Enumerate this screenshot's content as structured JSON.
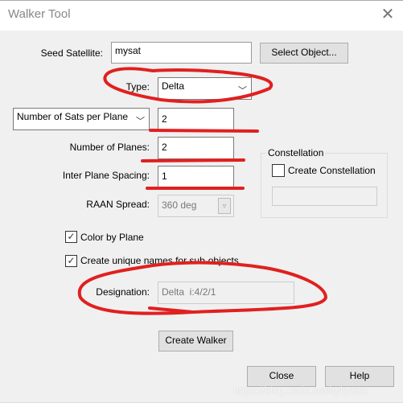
{
  "window": {
    "title": "Walker Tool",
    "close_icon": "close-icon"
  },
  "form": {
    "seed_label": "Seed Satellite:",
    "seed_value": "mysat",
    "select_object": "Select Object...",
    "type_label": "Type:",
    "type_value": "Delta",
    "sats_mode": "Number of Sats per Plane",
    "sats_value": "2",
    "planes_label": "Number of Planes:",
    "planes_value": "2",
    "spacing_label": "Inter Plane Spacing:",
    "spacing_value": "1",
    "raan_label": "RAAN Spread:",
    "raan_value": "360 deg",
    "color_by_plane": "Color by Plane",
    "color_by_plane_checked": true,
    "unique_names": "Create unique names for sub-objects",
    "unique_names_checked": true,
    "designation_label": "Designation:",
    "designation_value": "Delta  i:4/2/1",
    "create_walker": "Create Walker"
  },
  "constellation": {
    "legend": "Constellation",
    "create_label": "Create Constellation",
    "checked": false,
    "name_value": ""
  },
  "footer": {
    "close": "Close",
    "help": "Help"
  },
  "watermark": "https://blog.csdn.net/ltylty001",
  "annotation_color": "#e02020"
}
